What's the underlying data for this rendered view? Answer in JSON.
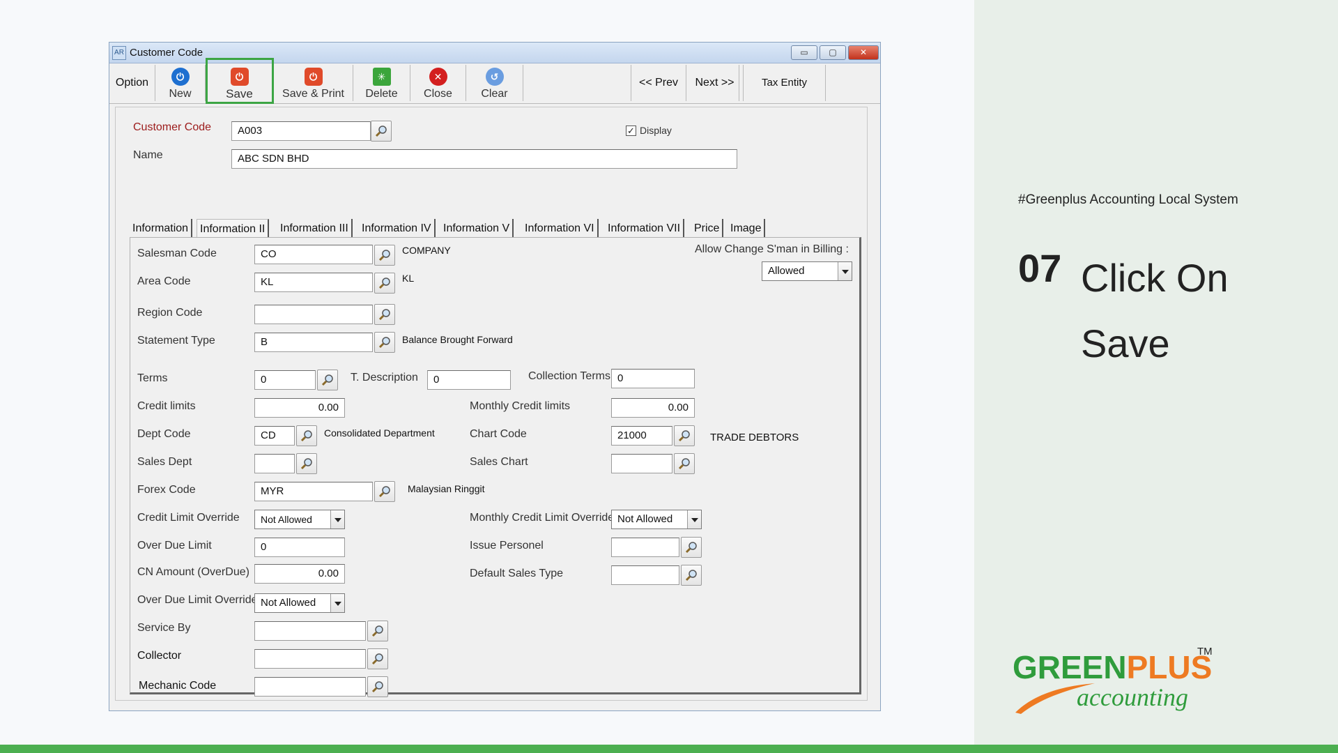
{
  "window": {
    "title": "Customer Code",
    "app_icon_text": "AR",
    "controls": {
      "minimize": "▭",
      "maximize": "▢",
      "close": "✕"
    }
  },
  "toolbar": {
    "option_label": "Option",
    "new_label": "New",
    "save_label": "Save",
    "save_print_label": "Save & Print",
    "delete_label": "Delete",
    "close_label": "Close",
    "clear_label": "Clear",
    "prev_label": "<<  Prev",
    "next_label": "Next  >>",
    "tax_entity_label": "Tax Entity"
  },
  "header": {
    "customer_code_label": "Customer Code",
    "customer_code_value": "A003",
    "name_label": "Name",
    "name_value": "ABC SDN BHD",
    "display_label": "Display",
    "display_checked": "✓"
  },
  "tabs": [
    {
      "label": "Information"
    },
    {
      "label": "Information II"
    },
    {
      "label": "Information III"
    },
    {
      "label": "Information IV"
    },
    {
      "label": "Information V"
    },
    {
      "label": "Information VI"
    },
    {
      "label": "Information VII"
    },
    {
      "label": "Price"
    },
    {
      "label": "Image"
    }
  ],
  "form": {
    "salesman_code": {
      "label": "Salesman Code",
      "value": "CO",
      "desc": "COMPANY"
    },
    "area_code": {
      "label": "Area Code",
      "value": "KL",
      "desc": "KL"
    },
    "region_code": {
      "label": "Region Code",
      "value": ""
    },
    "statement_type": {
      "label": "Statement Type",
      "value": "B",
      "desc": "Balance Brought Forward"
    },
    "allow_change": {
      "label": "Allow Change S'man in Billing :",
      "value": "Allowed"
    },
    "terms": {
      "label": "Terms",
      "value": "0"
    },
    "t_description": {
      "label": "T. Description",
      "value": "0"
    },
    "collection_terms": {
      "label": "Collection Terms",
      "value": "0"
    },
    "credit_limits": {
      "label": "Credit limits",
      "value": "0.00"
    },
    "monthly_credit_limits": {
      "label": "Monthly Credit limits",
      "value": "0.00"
    },
    "dept_code": {
      "label": "Dept Code",
      "value": "CD",
      "desc": "Consolidated Department"
    },
    "chart_code": {
      "label": "Chart Code",
      "value": "21000",
      "desc": "TRADE DEBTORS"
    },
    "sales_dept": {
      "label": "Sales Dept",
      "value": ""
    },
    "sales_chart": {
      "label": "Sales Chart",
      "value": ""
    },
    "forex_code": {
      "label": "Forex Code",
      "value": "MYR",
      "desc": "Malaysian Ringgit"
    },
    "credit_limit_override": {
      "label": "Credit Limit Override",
      "value": "Not Allowed"
    },
    "monthly_credit_limit_override": {
      "label": "Monthly Credit Limit Override",
      "value": "Not Allowed"
    },
    "over_due_limit": {
      "label": "Over Due Limit",
      "value": "0"
    },
    "issue_personel": {
      "label": "Issue Personel",
      "value": ""
    },
    "cn_amount": {
      "label": "CN Amount (OverDue)",
      "value": "0.00"
    },
    "default_sales_type": {
      "label": "Default Sales Type",
      "value": ""
    },
    "over_due_limit_override": {
      "label": "Over Due Limit Override",
      "value": "Not Allowed"
    },
    "service_by": {
      "label": "Service By",
      "value": ""
    },
    "collector": {
      "label": "Collector",
      "value": ""
    },
    "mechanic_code": {
      "label": "Mechanic Code",
      "value": ""
    }
  },
  "slide": {
    "hashtag": "#Greenplus Accounting Local System",
    "step_number": "07",
    "step_text": "Click On Save",
    "logo_green": "GREEN",
    "logo_plus": "PLUS",
    "logo_tm": "TM",
    "logo_sub": "accounting"
  },
  "colors": {
    "highlight": "#3ca544",
    "brand_green": "#2f9c3c",
    "brand_orange": "#ee7a22",
    "bottom_bar": "#4caf50"
  }
}
